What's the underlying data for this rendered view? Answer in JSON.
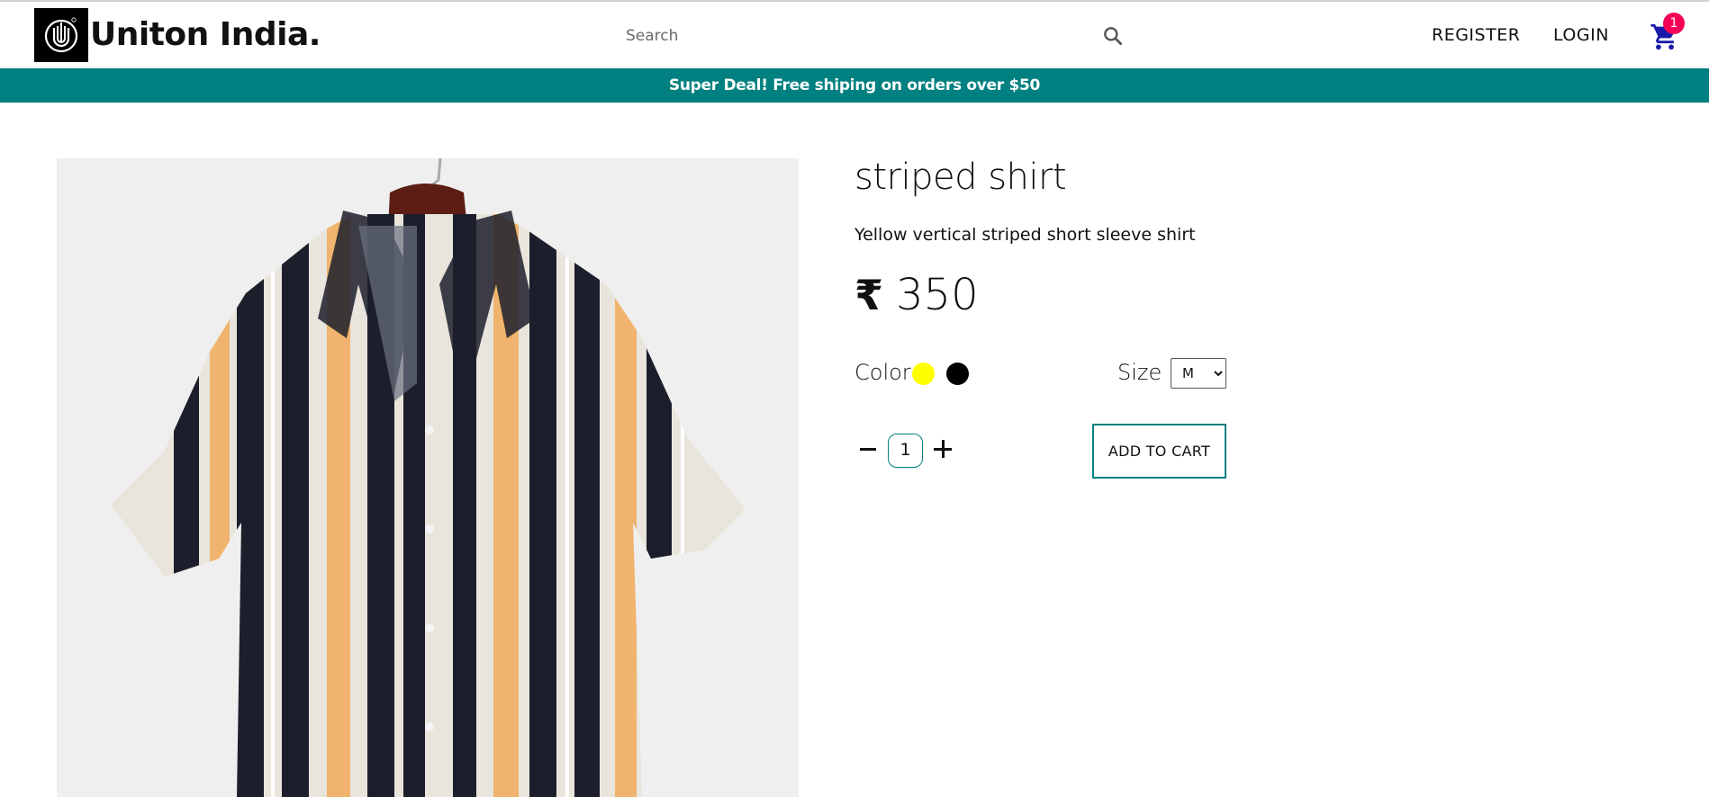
{
  "header": {
    "brand": "Uniton India.",
    "search_placeholder": "Search",
    "register_label": "REGISTER",
    "login_label": "LOGIN",
    "cart_count": "1"
  },
  "announcement": {
    "text": "Super Deal! Free shiping on orders over $50"
  },
  "product": {
    "title": "striped shirt",
    "description": "Yellow vertical striped short sleeve shirt",
    "currency_symbol": "₹",
    "price": "350",
    "color_label": "Color",
    "colors": [
      "#ffff00",
      "#000000"
    ],
    "size_label": "Size",
    "selected_size": "M",
    "quantity": "1",
    "add_to_cart_label": "ADD TO CART"
  },
  "theme": {
    "accent": "#008080",
    "badge": "#f50057",
    "cart_icon": "#1a1aaa"
  },
  "icons": {
    "search": "search-icon",
    "cart": "shopping-cart-icon",
    "minus": "minus-icon",
    "plus": "plus-icon"
  }
}
